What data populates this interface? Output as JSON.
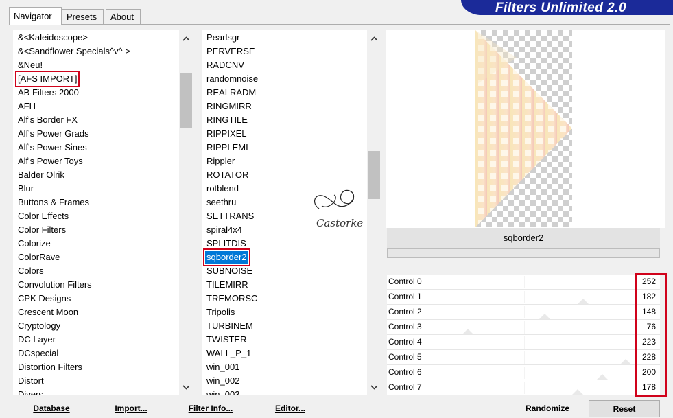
{
  "tabs": [
    {
      "label": "Navigator",
      "active": true
    },
    {
      "label": "Presets",
      "active": false
    },
    {
      "label": "About",
      "active": false
    }
  ],
  "brand": {
    "title": "Filters Unlimited 2.0",
    "color": "#1b2a99"
  },
  "categories": {
    "items": [
      "&<Kaleidoscope>",
      "&<Sandflower Specials^v^ >",
      "&Neu!",
      "[AFS IMPORT]",
      "AB Filters 2000",
      "AFH",
      "Alf's Border FX",
      "Alf's Power Grads",
      "Alf's Power Sines",
      "Alf's Power Toys",
      "Balder Olrik",
      "Blur",
      "Buttons & Frames",
      "Color Effects",
      "Color Filters",
      "Colorize",
      "ColorRave",
      "Colors",
      "Convolution Filters",
      "CPK Designs",
      "Crescent Moon",
      "Cryptology",
      "DC Layer",
      "DCspecial",
      "Distortion Filters",
      "Distort",
      "Divers"
    ],
    "selected": "[AFS IMPORT]"
  },
  "filters": {
    "items": [
      "Pearlsgr",
      "PERVERSE",
      "RADCNV",
      "randomnoise",
      "REALRADM",
      "RINGMIRR",
      "RINGTILE",
      "RIPPIXEL",
      "RIPPLEMI",
      "Rippler",
      "ROTATOR",
      "rotblend",
      "seethru",
      "SETTRANS",
      "spiral4x4",
      "SPLITDIS",
      "sqborder2",
      "SUBNOISE",
      "TILEMIRR",
      "TREMORSC",
      "Tripolis",
      "TURBINEM",
      "TWISTER",
      "WALL_P_1",
      "win_001",
      "win_002",
      "win_003"
    ],
    "selected": "sqborder2"
  },
  "watermark": {
    "text": "Castorke"
  },
  "preview": {
    "filter_name": "sqborder2"
  },
  "controls": [
    {
      "label": "Control 0",
      "value": "252"
    },
    {
      "label": "Control 1",
      "value": "182"
    },
    {
      "label": "Control 2",
      "value": "148"
    },
    {
      "label": "Control 3",
      "value": "76"
    },
    {
      "label": "Control 4",
      "value": "223"
    },
    {
      "label": "Control 5",
      "value": "228"
    },
    {
      "label": "Control 6",
      "value": "200"
    },
    {
      "label": "Control 7",
      "value": "178"
    }
  ],
  "buttons": {
    "database": "Database",
    "import": "Import...",
    "filter_info": "Filter Info...",
    "editor": "Editor...",
    "randomize": "Randomize",
    "reset": "Reset"
  },
  "colors": {
    "highlight_box": "#d0021b",
    "selection": "#0078d7"
  }
}
